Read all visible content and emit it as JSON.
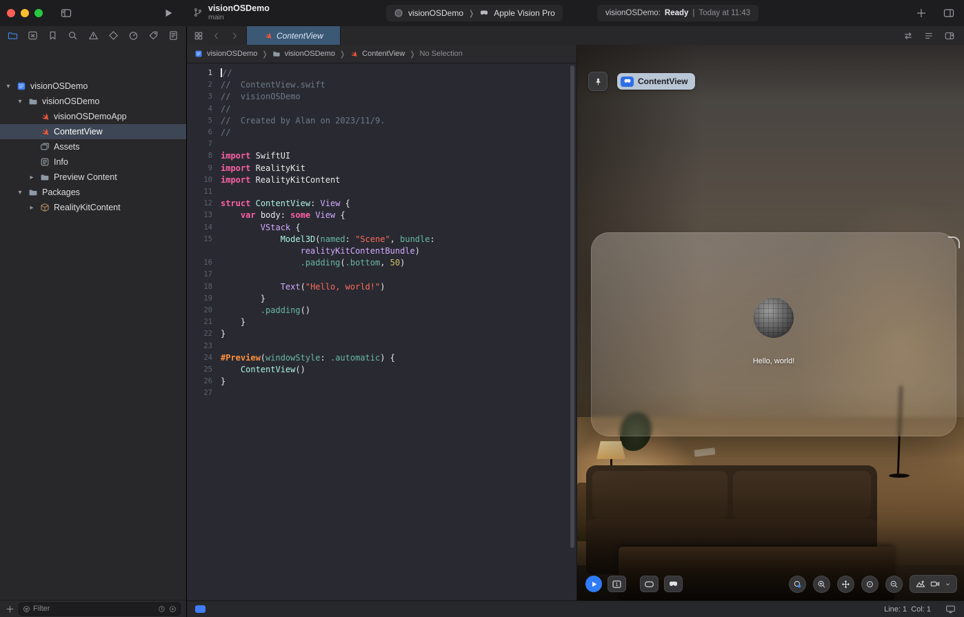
{
  "colors": {
    "accent": "#3f7dfc",
    "tab_active": "#3b5875",
    "keyword": "#fc5fa3",
    "string": "#fc6a5d",
    "number": "#d0bf69",
    "comment": "#6c7986",
    "type": "#d0a8ff",
    "project_type": "#acf2e4",
    "member": "#67b7a4",
    "macro": "#fd8f3f"
  },
  "titlebar": {
    "project": "visionOSDemo",
    "branch": "main",
    "scheme_name": "visionOSDemo",
    "destination": "Apple Vision Pro",
    "status_project": "visionOSDemo:",
    "status_state": "Ready",
    "status_divider": "|",
    "status_time": "Today at 11:43"
  },
  "sidebar": {
    "navigators": [
      {
        "icon": "nav-folder",
        "name": "project-navigator",
        "selected": true
      },
      {
        "icon": "nav-xsquare",
        "name": "source-control-navigator"
      },
      {
        "icon": "nav-bookmark",
        "name": "bookmarks-navigator"
      },
      {
        "icon": "nav-magnifier",
        "name": "find-navigator"
      },
      {
        "icon": "nav-warning",
        "name": "issues-navigator"
      },
      {
        "icon": "nav-diamond",
        "name": "tests-navigator"
      },
      {
        "icon": "nav-gauge",
        "name": "debug-navigator"
      },
      {
        "icon": "nav-tag",
        "name": "breakpoints-navigator"
      },
      {
        "icon": "nav-report",
        "name": "reports-navigator"
      }
    ],
    "tree": [
      {
        "label": "visionOSDemo",
        "icon": "project",
        "depth": 0,
        "state": "open"
      },
      {
        "label": "visionOSDemo",
        "icon": "folder",
        "depth": 1,
        "state": "open"
      },
      {
        "label": "visionOSDemoApp",
        "icon": "swift",
        "depth": 2
      },
      {
        "label": "ContentView",
        "icon": "swift",
        "depth": 2,
        "selected": true
      },
      {
        "label": "Assets",
        "icon": "assets",
        "depth": 2
      },
      {
        "label": "Info",
        "icon": "infolist",
        "depth": 2
      },
      {
        "label": "Preview Content",
        "icon": "folder",
        "depth": 2,
        "state": "closed"
      },
      {
        "label": "Packages",
        "icon": "folder",
        "depth": 1,
        "state": "open"
      },
      {
        "label": "RealityKitContent",
        "icon": "package",
        "depth": 2,
        "state": "closed"
      }
    ],
    "filter_placeholder": "Filter"
  },
  "tabbar": {
    "tabs": [
      {
        "label": "ContentView",
        "icon": "swift",
        "active": true
      }
    ]
  },
  "jumpbar": {
    "segments": [
      {
        "label": "visionOSDemo",
        "icon": "project"
      },
      {
        "label": "visionOSDemo",
        "icon": "folder"
      },
      {
        "label": "ContentView",
        "icon": "swift"
      },
      {
        "label": "No Selection",
        "icon": null
      }
    ]
  },
  "code": {
    "lines": [
      {
        "n": "1",
        "cursor": true,
        "t": [
          [
            "c",
            "//"
          ]
        ]
      },
      {
        "n": "2",
        "t": [
          [
            "c",
            "//  ContentView.swift"
          ]
        ]
      },
      {
        "n": "3",
        "t": [
          [
            "c",
            "//  visionOSDemo"
          ]
        ]
      },
      {
        "n": "4",
        "t": [
          [
            "c",
            "//"
          ]
        ]
      },
      {
        "n": "5",
        "t": [
          [
            "c",
            "//  Created by Alan on 2023/11/9."
          ]
        ]
      },
      {
        "n": "6",
        "t": [
          [
            "c",
            "//"
          ]
        ]
      },
      {
        "n": "7",
        "t": []
      },
      {
        "n": "8",
        "t": [
          [
            "k",
            "import"
          ],
          [
            "p",
            " SwiftUI"
          ]
        ]
      },
      {
        "n": "9",
        "t": [
          [
            "k",
            "import"
          ],
          [
            "p",
            " RealityKit"
          ]
        ]
      },
      {
        "n": "10",
        "t": [
          [
            "k",
            "import"
          ],
          [
            "p",
            " RealityKitContent"
          ]
        ]
      },
      {
        "n": "11",
        "t": []
      },
      {
        "n": "12",
        "t": [
          [
            "k",
            "struct"
          ],
          [
            "p",
            " "
          ],
          [
            "m",
            "ContentView"
          ],
          [
            "p",
            ": "
          ],
          [
            "y",
            "View"
          ],
          [
            "p",
            " {"
          ]
        ]
      },
      {
        "n": "13",
        "t": [
          [
            "p",
            "    "
          ],
          [
            "k",
            "var"
          ],
          [
            "p",
            " body: "
          ],
          [
            "k",
            "some"
          ],
          [
            "p",
            " "
          ],
          [
            "y",
            "View"
          ],
          [
            "p",
            " {"
          ]
        ]
      },
      {
        "n": "14",
        "t": [
          [
            "p",
            "        "
          ],
          [
            "y",
            "VStack"
          ],
          [
            "p",
            " {"
          ]
        ]
      },
      {
        "n": "15",
        "t": [
          [
            "p",
            "            "
          ],
          [
            "m",
            "Model3D"
          ],
          [
            "p",
            "("
          ],
          [
            "f",
            "named"
          ],
          [
            "p",
            ": "
          ],
          [
            "s",
            "\"Scene\""
          ],
          [
            "p",
            ", "
          ],
          [
            "f",
            "bundle"
          ],
          [
            "p",
            ":"
          ]
        ]
      },
      {
        "n": "",
        "t": [
          [
            "p",
            "                "
          ],
          [
            "y",
            "realityKitContentBundle"
          ],
          [
            "p",
            ")"
          ]
        ]
      },
      {
        "n": "16",
        "t": [
          [
            "p",
            "                "
          ],
          [
            "f",
            ".padding"
          ],
          [
            "p",
            "("
          ],
          [
            "f",
            ".bottom"
          ],
          [
            "p",
            ", "
          ],
          [
            "n",
            "50"
          ],
          [
            "p",
            ")"
          ]
        ]
      },
      {
        "n": "17",
        "t": []
      },
      {
        "n": "18",
        "t": [
          [
            "p",
            "            "
          ],
          [
            "y",
            "Text"
          ],
          [
            "p",
            "("
          ],
          [
            "s",
            "\"Hello, world!\""
          ],
          [
            "p",
            ")"
          ]
        ]
      },
      {
        "n": "19",
        "t": [
          [
            "p",
            "        }"
          ]
        ]
      },
      {
        "n": "20",
        "t": [
          [
            "p",
            "        "
          ],
          [
            "f",
            ".padding"
          ],
          [
            "p",
            "()"
          ]
        ]
      },
      {
        "n": "21",
        "t": [
          [
            "p",
            "    }"
          ]
        ]
      },
      {
        "n": "22",
        "t": [
          [
            "p",
            "}"
          ]
        ]
      },
      {
        "n": "23",
        "t": []
      },
      {
        "n": "24",
        "t": [
          [
            "o",
            "#Preview"
          ],
          [
            "p",
            "("
          ],
          [
            "f",
            "windowStyle"
          ],
          [
            "p",
            ": "
          ],
          [
            "f",
            ".automatic"
          ],
          [
            "p",
            ") {"
          ]
        ]
      },
      {
        "n": "25",
        "t": [
          [
            "p",
            "    "
          ],
          [
            "m",
            "ContentView"
          ],
          [
            "p",
            "()"
          ]
        ]
      },
      {
        "n": "26",
        "t": [
          [
            "p",
            "}"
          ]
        ]
      },
      {
        "n": "27",
        "t": []
      }
    ]
  },
  "canvas": {
    "preview_pill": "ContentView",
    "hello_text": "Hello, world!",
    "toolbar_left": [
      {
        "name": "live-preview-button",
        "icon": "play",
        "style": "blue-circle"
      },
      {
        "name": "selectable-mode-button",
        "icon": "screen1",
        "style": ""
      },
      {
        "name": "device-bezel-button",
        "icon": "bezel",
        "style": "gap"
      },
      {
        "name": "vision-pro-preview-button",
        "icon": "goggles",
        "style": ""
      }
    ],
    "toolbar_right": [
      {
        "name": "inspect-button",
        "icon": "targetdot"
      },
      {
        "name": "zoom-in-button",
        "icon": "zoomin"
      },
      {
        "name": "pan-button",
        "icon": "pan"
      },
      {
        "name": "recenter-button",
        "icon": "center"
      },
      {
        "name": "zoom-out-button",
        "icon": "zoomout"
      }
    ]
  },
  "statusbar": {
    "line_col": "Line: 1  Col: 1"
  }
}
